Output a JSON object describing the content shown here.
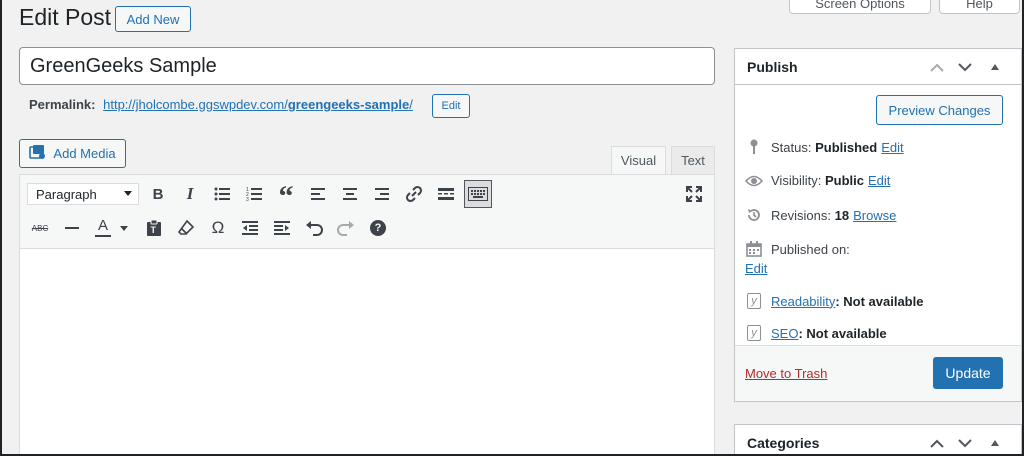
{
  "header": {
    "title": "Edit Post",
    "add_new": "Add New",
    "screen_options": "Screen Options",
    "help": "Help"
  },
  "post": {
    "title": "GreenGeeks Sample",
    "permalink_label": "Permalink:",
    "permalink_base": "http://jholcombe.ggswpdev.com/",
    "permalink_slug": "greengeeks-sample",
    "permalink_trailing": "/",
    "permalink_edit": "Edit"
  },
  "editor": {
    "add_media": "Add Media",
    "tab_visual": "Visual",
    "tab_text": "Text",
    "format_select": "Paragraph",
    "toolbar_row1": [
      "bold-icon",
      "italic-icon",
      "bullet-list-icon",
      "numbered-list-icon",
      "blockquote-icon",
      "align-left-icon",
      "align-center-icon",
      "align-right-icon",
      "link-icon",
      "read-more-icon",
      "toolbar-toggle-icon",
      "fullscreen-icon"
    ],
    "toolbar_row2": [
      "strikethrough-icon",
      "horizontal-line-icon",
      "text-color-icon",
      "paste-text-icon",
      "clear-formatting-icon",
      "special-character-icon",
      "decrease-indent-icon",
      "increase-indent-icon",
      "undo-icon",
      "redo-icon",
      "help-icon"
    ],
    "bold_glyph": "B",
    "italic_glyph": "I",
    "quote_glyph": "“",
    "omega_glyph": "Ω",
    "text_color_glyph": "A",
    "strike_glyph": "ABC",
    "help_glyph": "?"
  },
  "publish": {
    "title": "Publish",
    "preview": "Preview Changes",
    "status_label": "Status:",
    "status_value": "Published",
    "status_edit": "Edit",
    "visibility_label": "Visibility:",
    "visibility_value": "Public",
    "visibility_edit": "Edit",
    "revisions_label": "Revisions:",
    "revisions_value": "18",
    "revisions_link": "Browse",
    "published_on_label": "Published on:",
    "published_on_edit": "Edit",
    "readability_link": "Readability",
    "readability_value": ": Not available",
    "seo_link": "SEO",
    "seo_value": ": Not available",
    "trash": "Move to Trash",
    "update": "Update"
  },
  "categories": {
    "title": "Categories"
  },
  "colors": {
    "accent": "#2271b1",
    "trash": "#b32d2e",
    "background": "#f1f1f1"
  }
}
